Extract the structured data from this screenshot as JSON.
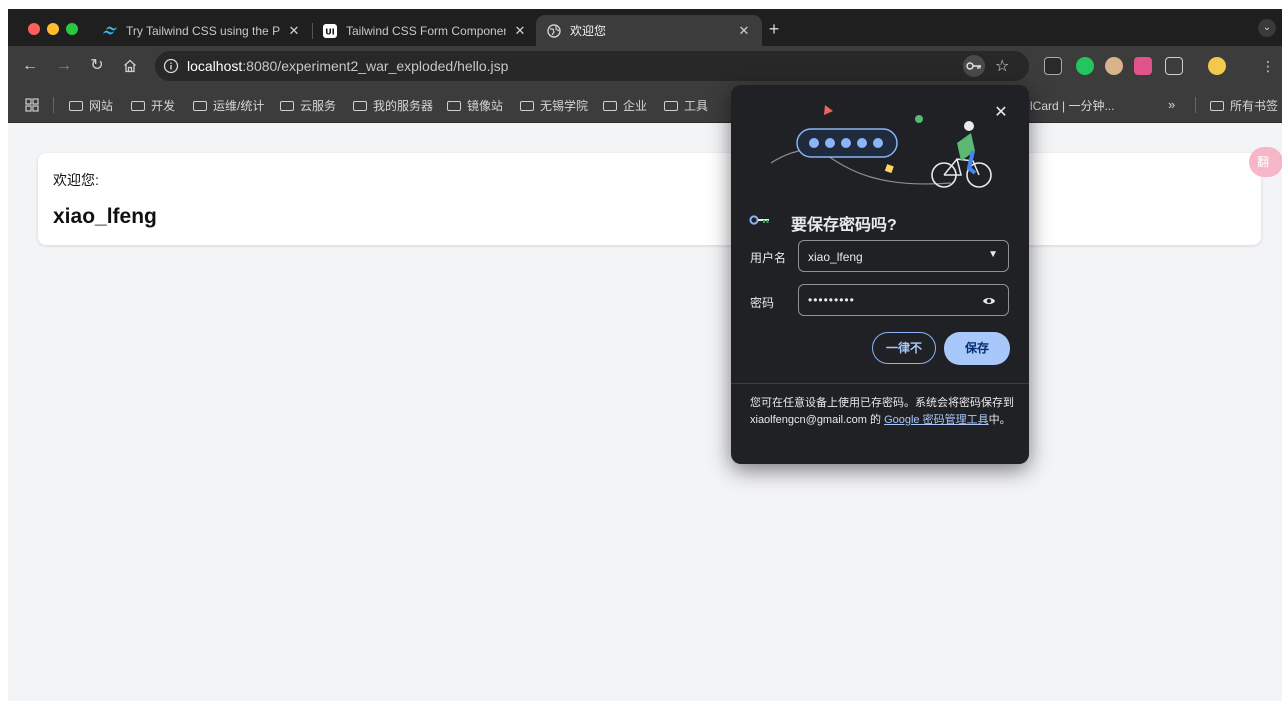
{
  "browser": {
    "tabs": [
      {
        "title": "Try Tailwind CSS using the Pl",
        "active": false
      },
      {
        "title": "Tailwind CSS Form Componen",
        "active": false
      },
      {
        "title": "欢迎您",
        "active": true
      }
    ],
    "new_tab_label": "+",
    "url_host": "localhost",
    "url_rest": ":8080/experiment2_war_exploded/hello.jsp",
    "bookmarks": [
      {
        "label": "网站"
      },
      {
        "label": "开发"
      },
      {
        "label": "运维/统计"
      },
      {
        "label": "云服务"
      },
      {
        "label": "我的服务器"
      },
      {
        "label": "镜像站"
      },
      {
        "label": "无锡学院"
      },
      {
        "label": "企业"
      },
      {
        "label": "工具"
      }
    ],
    "bookmark_partial": "lCard | 一分钟...",
    "bookmark_more": "»",
    "bookmark_all": "所有书签"
  },
  "page": {
    "welcome_text": "欢迎您:",
    "username": "xiao_lfeng",
    "side_bubble": "翻"
  },
  "password_popup": {
    "title": "要保存密码吗?",
    "username_label": "用户名",
    "username_value": "xiao_lfeng",
    "password_label": "密码",
    "password_value": "•••••••••",
    "never_button": "一律不",
    "save_button": "保存",
    "footer_text_1": "您可在任意设备上使用已存密码。系统会将密码保存到 xiaolfengcn@gmail.com 的 ",
    "footer_link": "Google 密码管理工具",
    "footer_text_2": "中。"
  },
  "colors": {
    "accent_blue": "#a8c7fa",
    "popup_bg": "#202124",
    "toolbar_bg": "#3c3c3c"
  }
}
